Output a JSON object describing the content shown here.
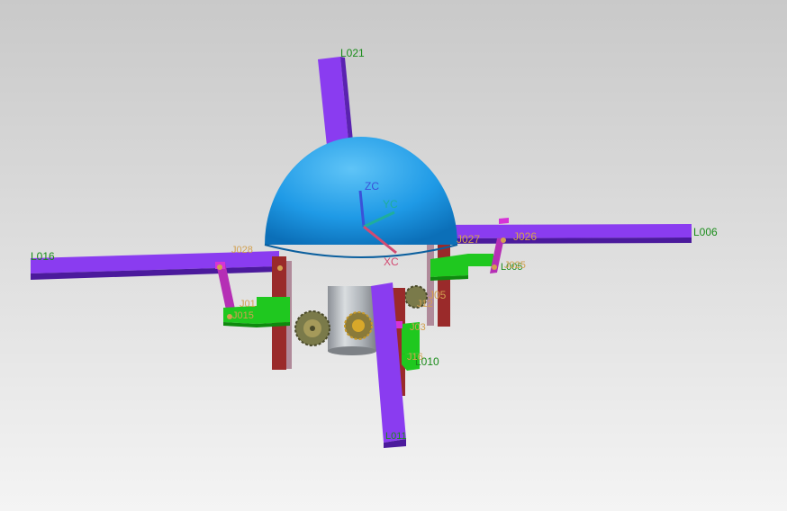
{
  "colors": {
    "link": "#8a3cf0",
    "link_dark": "#4b1a9c",
    "dome": "#29a4ec",
    "green": "#1fc81f",
    "post": "#9a2a2a",
    "magenta": "#d633d6",
    "link_label": "#1a8c1a",
    "joint_label": "#d2a050",
    "axis_z": "#3a52d8",
    "axis_y": "#1fae9c",
    "axis_x": "#d24a72"
  },
  "axes": {
    "zc": "ZC",
    "yc": "YC",
    "xc": "XC"
  },
  "labels": {
    "l021": "L021",
    "l006": "L006",
    "l016": "L016",
    "l010": "L010",
    "l005": "L005",
    "l011": "L011",
    "j026": "J026",
    "j027": "J027",
    "j028": "J028",
    "j025": "J025",
    "j015": "J015",
    "j01x": "J01",
    "j03": "J03",
    "j05": "J05",
    "j12": "J12",
    "j16": "J16"
  }
}
